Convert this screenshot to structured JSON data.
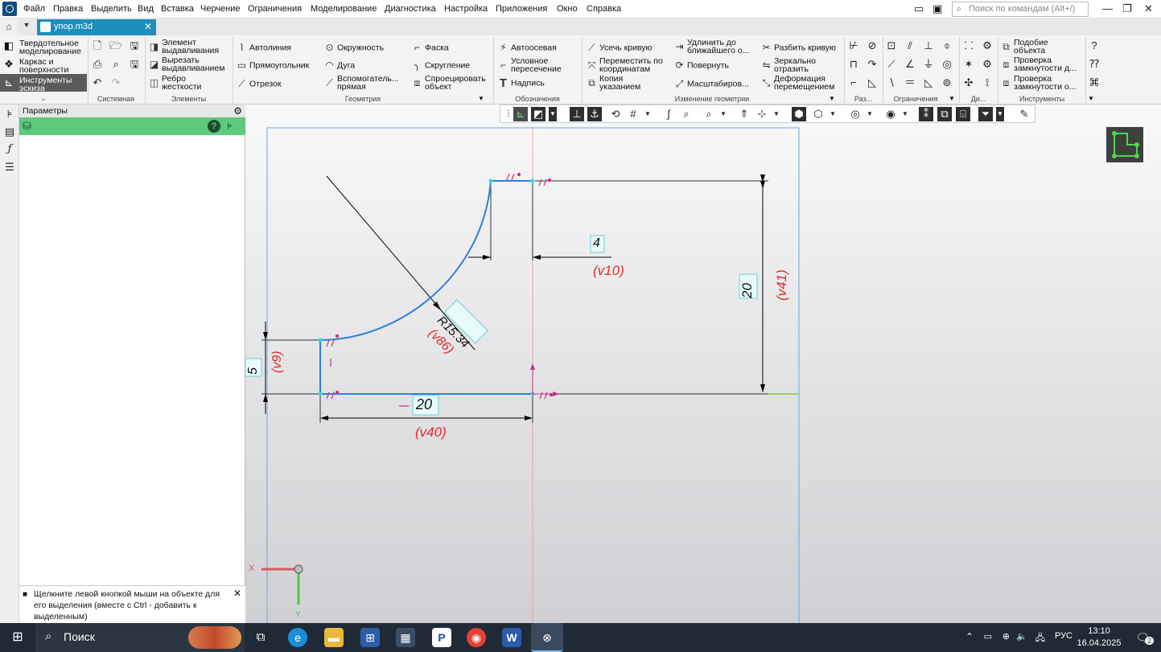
{
  "menu": {
    "items": [
      "Файл",
      "Правка",
      "Выделить",
      "Вид",
      "Вставка",
      "Черчение",
      "Ограничения",
      "Моделирование",
      "Диагностика",
      "Настройка",
      "Приложения",
      "Окно",
      "Справка"
    ],
    "search_placeholder": "Поиск по командам (Alt+/)"
  },
  "tab": {
    "title": "упор.m3d"
  },
  "modes": [
    {
      "label1": "Твердотельное",
      "label2": "моделирование"
    },
    {
      "label1": "Каркас и",
      "label2": "поверхности"
    },
    {
      "label1": "Инструменты",
      "label2": "эскиза"
    }
  ],
  "ribbon": {
    "groups": [
      "Системная",
      "Элементы",
      "Геометрия",
      "Обозначения",
      "Изменение геометрии",
      "Раз...",
      "Ограничения",
      "Ди...",
      "Инструменты"
    ],
    "elements": [
      {
        "l1": "Элемент",
        "l2": "выдавливания"
      },
      {
        "l1": "Вырезать",
        "l2": "выдавливанием"
      },
      {
        "l1": "Ребро",
        "l2": "жесткости"
      }
    ],
    "geometry": {
      "col1": [
        "Автолиния",
        "Прямоугольник",
        "Отрезок"
      ],
      "col2": [
        "Окружность",
        "Дуга"
      ],
      "col2_3a": "Вспомогатель...",
      "col2_3b": "прямая",
      "col3": [
        "Фаска",
        "Скругление"
      ],
      "col3_3a": "Спроецировать",
      "col3_3b": "объект"
    },
    "annotations": {
      "a1": "Автоосевая",
      "a2a": "Условное",
      "a2b": "пересечение",
      "a3": "Надпись"
    },
    "modify": {
      "m1": "Усечь кривую",
      "m2a": "Переместить по",
      "m2b": "координатам",
      "m3a": "Копия",
      "m3b": "указанием",
      "n1a": "Удлинить до",
      "n1b": "ближайшего о...",
      "n2": "Повернуть",
      "n3": "Масштабиров...",
      "o1": "Разбить кривую",
      "o2a": "Зеркально",
      "o2b": "отразить",
      "o3a": "Деформация",
      "o3b": "перемещением"
    },
    "tools": {
      "t1a": "Подобие",
      "t1b": "объекта",
      "t2a": "Проверка",
      "t2b": "замкнутости д...",
      "t3a": "Проверка",
      "t3b": "замкнутости о..."
    }
  },
  "params": {
    "title": "Параметры"
  },
  "hint": {
    "text": "Щелкните левой кнопкой мыши на объекте для его выделения (вместе с Ctrl - добавить к выделенным)"
  },
  "sketch": {
    "dim_4": "4",
    "var_4": "(v10)",
    "dim_20v": "20",
    "var_20v": "(v41)",
    "dim_r": "R15.34",
    "var_r": "(v86)",
    "dim_5": "5",
    "var_5": "(v9)",
    "dim_20h": "20",
    "var_20h": "(v40)",
    "axis_x": "X",
    "axis_y": "Y"
  },
  "taskbar": {
    "search": "Поиск",
    "lang": "РУС",
    "time": "13:10",
    "date": "16.04.2025",
    "notif": "2"
  }
}
